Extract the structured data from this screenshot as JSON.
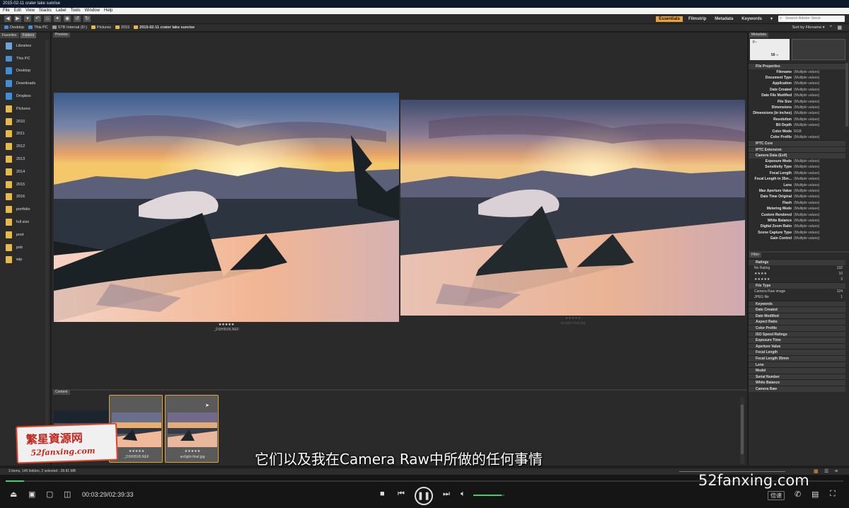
{
  "window": {
    "title": "2015-02-11 crater lake sunrise"
  },
  "menu": [
    "File",
    "Edit",
    "View",
    "Stacks",
    "Label",
    "Tools",
    "Window",
    "Help"
  ],
  "workspaces": [
    "Essentials",
    "Filmstrip",
    "Metadata",
    "Keywords"
  ],
  "search_placeholder": "Search Adobe Stock",
  "sort_label": "Sort by Filename",
  "breadcrumb": [
    "Desktop",
    "This PC",
    "STB Internal (D:)",
    "Pictures",
    "2015",
    "2015-02-11 crater lake sunrise"
  ],
  "left_tabs": [
    "Favorites",
    "Folders"
  ],
  "folders": [
    {
      "label": "Libraries",
      "icon": "libraries-icon"
    },
    {
      "label": "This PC",
      "icon": "computer-icon"
    },
    {
      "label": "Desktop",
      "icon": "desktop-icon"
    },
    {
      "label": "Downloads",
      "icon": "downloads-icon"
    },
    {
      "label": "Dropbox",
      "icon": "dropbox-icon"
    },
    {
      "label": "Pictures",
      "icon": "folder-icon"
    },
    {
      "label": "2010",
      "icon": "folder-icon"
    },
    {
      "label": "2011",
      "icon": "folder-icon"
    },
    {
      "label": "2012",
      "icon": "folder-icon"
    },
    {
      "label": "2013",
      "icon": "folder-icon"
    },
    {
      "label": "2014",
      "icon": "folder-icon"
    },
    {
      "label": "2015",
      "icon": "folder-icon"
    },
    {
      "label": "2016",
      "icon": "folder-icon"
    },
    {
      "label": "portfolio",
      "icon": "folder-icon"
    },
    {
      "label": "full size",
      "icon": "folder-icon"
    },
    {
      "label": "post",
      "icon": "folder-icon"
    },
    {
      "label": "psb",
      "icon": "folder-icon"
    },
    {
      "label": "wip",
      "icon": "folder-icon"
    }
  ],
  "preview": {
    "tab": "Preview",
    "left_stars": "★★★★★",
    "left_name": "_DSH9595.NEF",
    "right_stars": "★★★★★",
    "right_name": "arclight-final.jpg"
  },
  "content": {
    "tab": "Content",
    "thumbs": [
      {
        "stars": "★★★★★",
        "name": "_DSH9595.NEF"
      },
      {
        "stars": "★★★★★",
        "name": "arclight-final.jpg"
      }
    ]
  },
  "metadata": {
    "tab": "Metadata",
    "camera_readout": {
      "aperture": "f/--",
      "meter": "50 --"
    },
    "file_properties_title": "File Properties",
    "file_properties": [
      [
        "Filename",
        "(Multiple values)"
      ],
      [
        "Document Type",
        "(Multiple values)"
      ],
      [
        "Application",
        "(Multiple values)"
      ],
      [
        "Date Created",
        "(Multiple values)"
      ],
      [
        "Date File Modified",
        "(Multiple values)"
      ],
      [
        "File Size",
        "(Multiple values)"
      ],
      [
        "Dimensions",
        "(Multiple values)"
      ],
      [
        "Dimensions (in inches)",
        "(Multiple values)"
      ],
      [
        "Resolution",
        "(Multiple values)"
      ],
      [
        "Bit Depth",
        "(Multiple values)"
      ],
      [
        "Color Mode",
        "RGB"
      ],
      [
        "Color Profile",
        "(Multiple values)"
      ]
    ],
    "sections": [
      "IPTC Core",
      "IPTC Extension"
    ],
    "camera_data_title": "Camera Data (Exif)",
    "camera_data": [
      [
        "Exposure Mode",
        "(Multiple values)"
      ],
      [
        "Sensitivity Type",
        "(Multiple values)"
      ],
      [
        "Focal Length",
        "(Multiple values)"
      ],
      [
        "Focal Length in 35m...",
        "(Multiple values)"
      ],
      [
        "Lens",
        "(Multiple values)"
      ],
      [
        "Max Aperture Value",
        "(Multiple values)"
      ],
      [
        "Date Time Original",
        "(Multiple values)"
      ],
      [
        "Flash",
        "(Multiple values)"
      ],
      [
        "Metering Mode",
        "(Multiple values)"
      ],
      [
        "Custom Rendered",
        "(Multiple values)"
      ],
      [
        "White Balance",
        "(Multiple values)"
      ],
      [
        "Digital Zoom Ratio",
        "(Multiple values)"
      ],
      [
        "Scene Capture Type",
        "(Multiple values)"
      ],
      [
        "Gain Control",
        "(Multiple values)"
      ]
    ]
  },
  "filter": {
    "tab": "Filter",
    "ratings_title": "Ratings",
    "ratings": [
      [
        "No Rating",
        "132"
      ],
      [
        "★★★★",
        "10"
      ],
      [
        "★★★★★",
        "3"
      ]
    ],
    "filetype_title": "File Type",
    "filetypes": [
      [
        "Camera Raw image",
        "124"
      ],
      [
        "JPEG file",
        "1"
      ]
    ],
    "sections": [
      "Keywords",
      "Date Created",
      "Date Modified",
      "Aspect Ratio",
      "Color Profile",
      "ISO Speed Ratings",
      "Exposure Time",
      "Aperture Value",
      "Focal Length",
      "Focal Length 35mm",
      "Lens",
      "Model",
      "Serial Number",
      "White Balance",
      "Camera Raw"
    ]
  },
  "status": "3 items, 145 hidden, 2 selected - 28.81 MB",
  "player": {
    "timecode": "00:03:29/02:39:33",
    "progress": 0.022,
    "volume": 0.9,
    "speed_label": "倍速"
  },
  "subtitle": "它们以及我在Camera Raw中所做的任何事情",
  "watermark": {
    "title": "繁星資源网",
    "sub": "52fanxing.com",
    "right": "52fanxing.com"
  },
  "colors": {
    "accent": "#e8a33d",
    "progress": "#3bd16f"
  }
}
